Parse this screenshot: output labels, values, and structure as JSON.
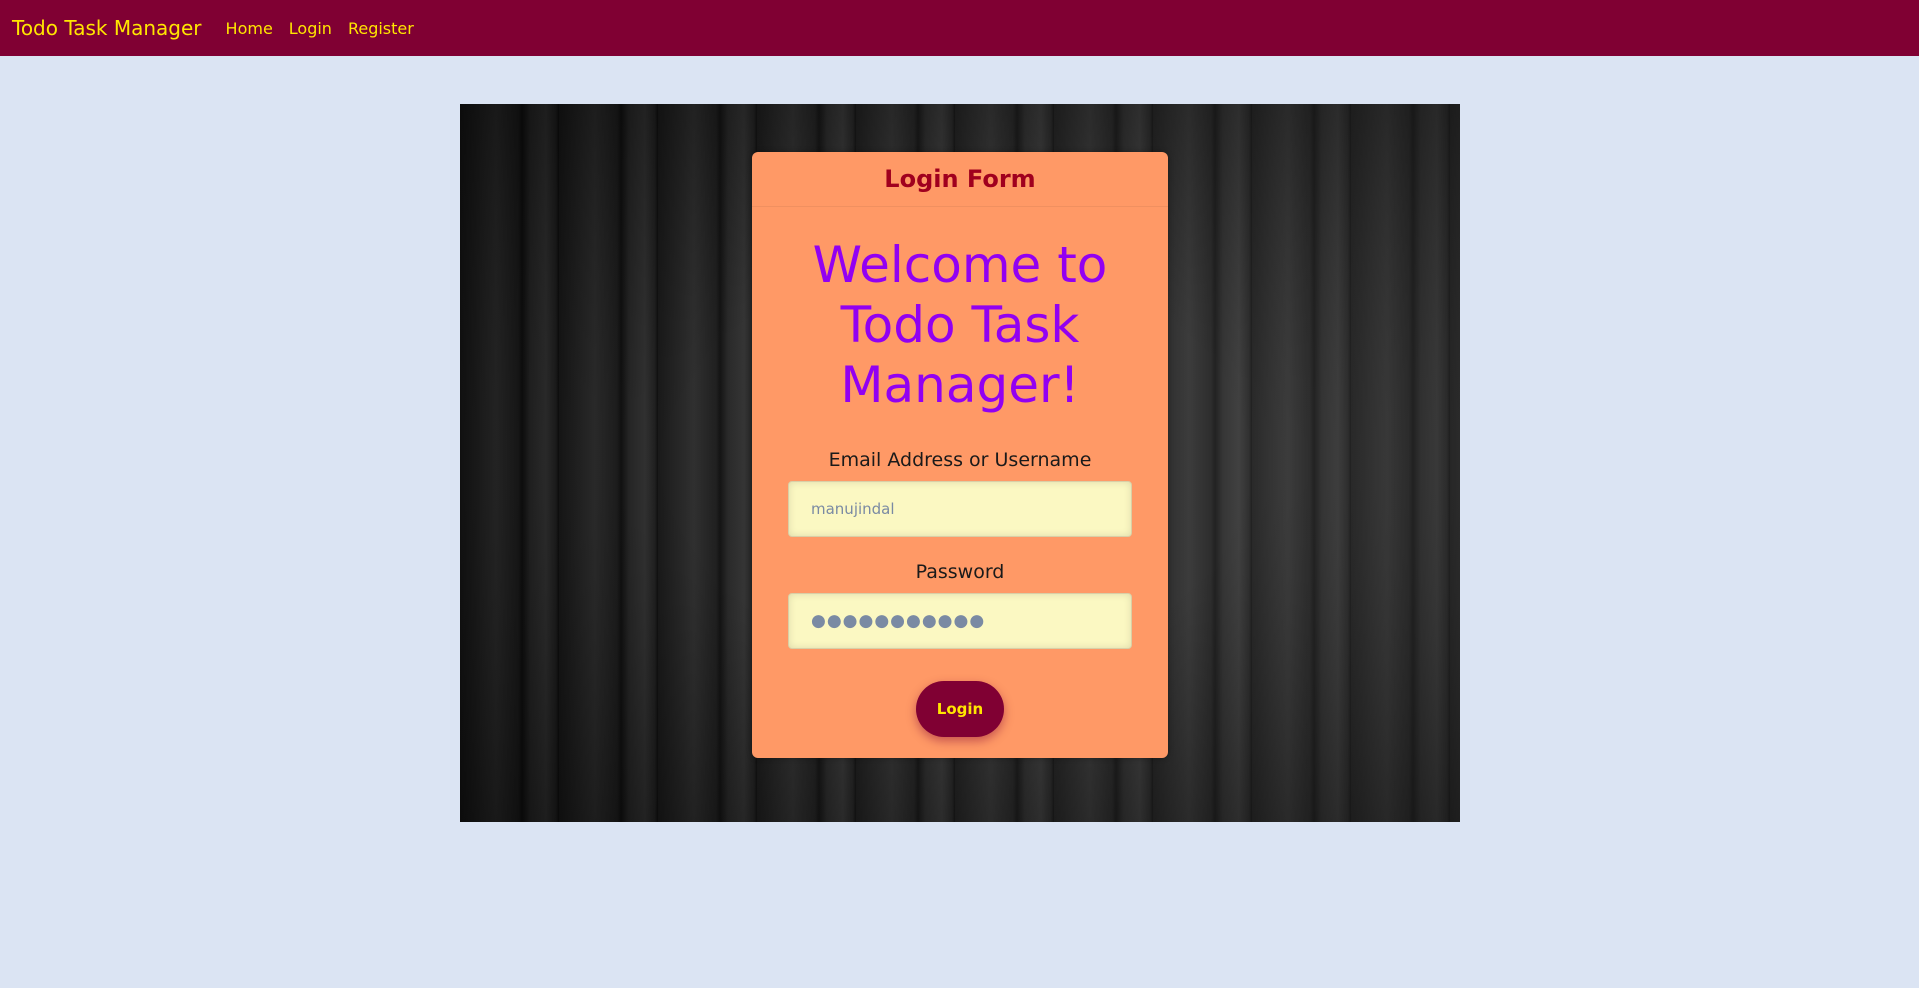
{
  "navbar": {
    "brand": "Todo Task Manager",
    "links": [
      "Home",
      "Login",
      "Register"
    ]
  },
  "login_card": {
    "header_title": "Login Form",
    "welcome_text": "Welcome to Todo Task Manager!",
    "email_label": "Email Address or Username",
    "email_value": "manujindal",
    "password_label": "Password",
    "password_value": "●●●●●●●●●●●",
    "login_button_label": "Login"
  },
  "colors": {
    "navbar_bg": "#800033",
    "nav_text": "#ffe600",
    "page_bg": "#dbe4f3",
    "card_bg": "#ff9966",
    "card_title": "#a0001e",
    "welcome_text": "#9200f2",
    "input_bg": "#fbf8c2",
    "button_bg": "#800033",
    "button_text": "#ffe600"
  }
}
